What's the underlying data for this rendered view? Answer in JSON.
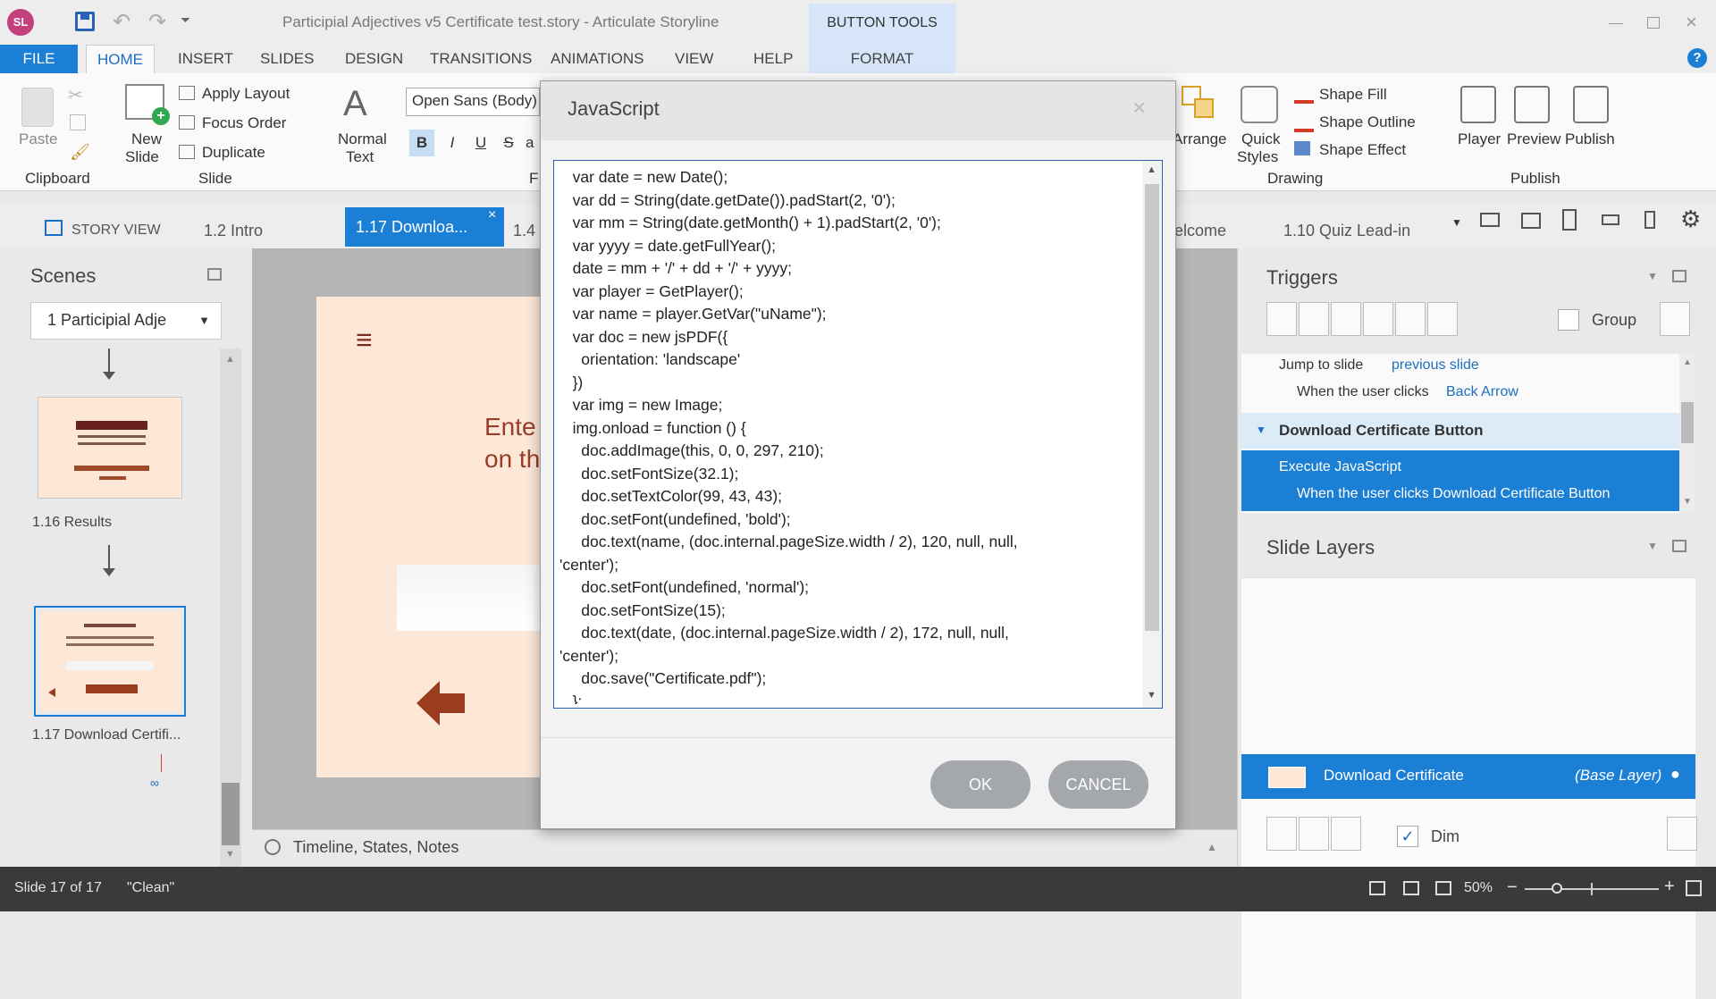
{
  "app": {
    "logo_text": "SL",
    "window_title": "Participial Adjectives v5 Certificate test.story - Articulate Storyline",
    "context_group": "BUTTON TOOLS"
  },
  "menu": {
    "file": "FILE",
    "tabs": [
      "HOME",
      "INSERT",
      "SLIDES",
      "DESIGN",
      "TRANSITIONS",
      "ANIMATIONS",
      "VIEW",
      "HELP"
    ],
    "format": "FORMAT"
  },
  "ribbon": {
    "paste": "Paste",
    "clipboard_group": "Clipboard",
    "new_slide_1": "New",
    "new_slide_2": "Slide",
    "apply_layout": "Apply Layout",
    "focus_order": "Focus Order",
    "duplicate": "Duplicate",
    "slide_group": "Slide",
    "normal_text_1": "Normal",
    "normal_text_2": "Text",
    "font_name": "Open Sans (Body)",
    "bold": "B",
    "italic": "I",
    "underline": "U",
    "strike": "S",
    "a": "a",
    "font_group_fragment": "F",
    "arrange": "Arrange",
    "quick_styles_1": "Quick",
    "quick_styles_2": "Styles",
    "shape_fill": "Shape Fill",
    "shape_outline": "Shape Outline",
    "shape_effect": "Shape Effect",
    "drawing_group": "Drawing",
    "player": "Player",
    "preview": "Preview",
    "publish": "Publish",
    "publish_group": "Publish"
  },
  "slide_tabs": {
    "story_view": "STORY VIEW",
    "t1": "1.2 Intro",
    "active": "1.17 Downloa...",
    "t3": "1.4",
    "t4": "elcome",
    "t5": "1.10 Quiz Lead-in"
  },
  "scenes": {
    "title": "Scenes",
    "dropdown": "1 Participial Adje",
    "slide1_label": "1.16 Results",
    "slide2_label": "1.17 Download Certifi..."
  },
  "canvas": {
    "menu_glyph": "≡",
    "text_line1": "Ente",
    "text_line2": "on th"
  },
  "timeline": {
    "label": "Timeline, States, Notes"
  },
  "triggers": {
    "title": "Triggers",
    "group_label": "Group",
    "t1_action": "Jump to slide ",
    "t1_target": "previous slide",
    "t1_when": "When the user clicks ",
    "t1_obj": "Back Arrow",
    "section": "Download Certificate Button",
    "t2_action": "Execute JavaScript",
    "t2_when": "When the user clicks Download Certificate Button"
  },
  "layers": {
    "title": "Slide Layers",
    "base_name": "Download Certificate",
    "base_tag": "(Base Layer)",
    "dim_label": "Dim"
  },
  "status": {
    "slide": "Slide 17 of 17",
    "theme": "\"Clean\"",
    "zoom": "50%"
  },
  "dialog": {
    "title": "JavaScript",
    "ok": "OK",
    "cancel": "CANCEL",
    "code": [
      "   var date = new Date();",
      "   var dd = String(date.getDate()).padStart(2, '0');",
      "   var mm = String(date.getMonth() + 1).padStart(2, '0');",
      "   var yyyy = date.getFullYear();",
      "   date = mm + '/' + dd + '/' + yyyy;",
      "   var player = GetPlayer();",
      "   var name = player.GetVar(\"uName\");",
      "   var doc = new jsPDF({",
      "     orientation: 'landscape'",
      "   })",
      "   var img = new Image;",
      "   img.onload = function () {",
      "     doc.addImage(this, 0, 0, 297, 210);",
      "     doc.setFontSize(32.1);",
      "     doc.setTextColor(99, 43, 43);",
      "     doc.setFont(undefined, 'bold');",
      "     doc.text(name, (doc.internal.pageSize.width / 2), 120, null, null,",
      "'center');",
      "     doc.setFont(undefined, 'normal');",
      "     doc.setFontSize(15);",
      "     doc.text(date, (doc.internal.pageSize.width / 2), 172, null, null,",
      "'center');",
      "     doc.save(\"Certificate.pdf\");",
      "   };"
    ]
  },
  "colors": {
    "accent": "#1c7fd6",
    "arrow": "#9a3c1e",
    "slide_bg": "#fde8d8"
  }
}
